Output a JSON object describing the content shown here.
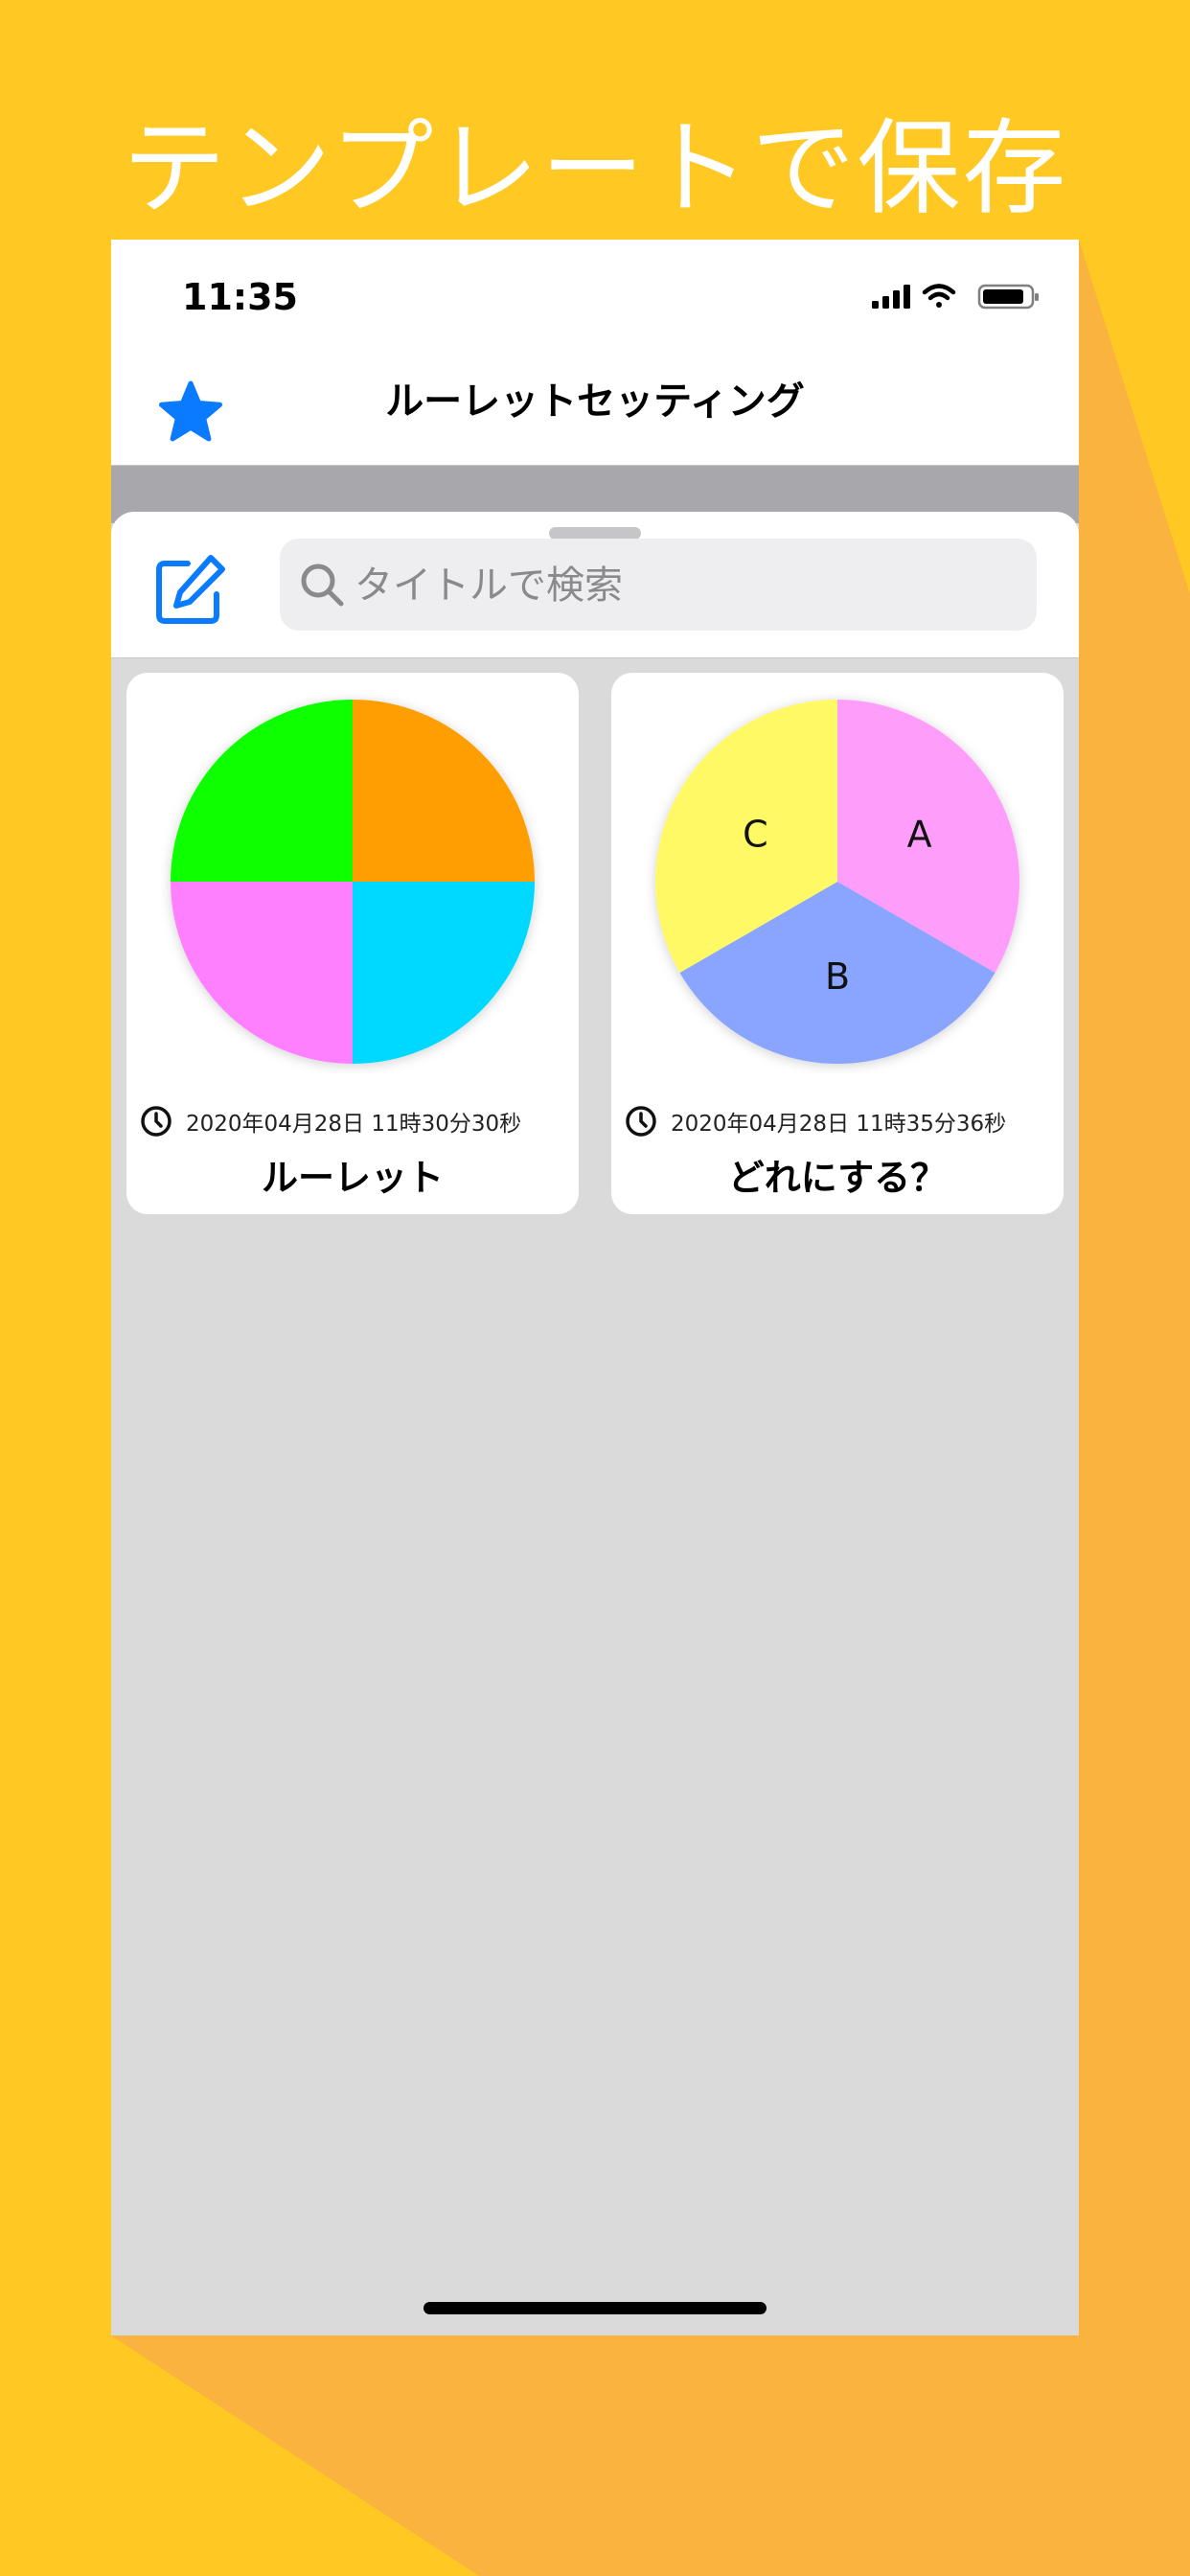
{
  "promo": {
    "headline": "テンプレートで保存"
  },
  "status_bar": {
    "time": "11:35"
  },
  "nav": {
    "title": "ルーレットセッティング",
    "favorite_icon": "star-icon"
  },
  "sheet": {
    "edit_icon": "edit-icon"
  },
  "search": {
    "placeholder": "タイトルで検索",
    "value": "",
    "icon": "search-icon"
  },
  "templates": [
    {
      "date": "2020年04月28日 11時30分30秒",
      "title": "ルーレット",
      "slices": [
        {
          "label": "",
          "color": "#FF9E00"
        },
        {
          "label": "",
          "color": "#00D9FF"
        },
        {
          "label": "",
          "color": "#FF80FF"
        },
        {
          "label": "",
          "color": "#11FF00"
        }
      ]
    },
    {
      "date": "2020年04月28日 11時35分36秒",
      "title": "どれにする？",
      "slices": [
        {
          "label": "A",
          "color": "#FF9EFA"
        },
        {
          "label": "B",
          "color": "#8AA5FF"
        },
        {
          "label": "C",
          "color": "#FFF966"
        }
      ]
    }
  ],
  "colors": {
    "background": "#FFC822",
    "accent": "#0A7AFF",
    "shadow": "#F9B33E"
  }
}
